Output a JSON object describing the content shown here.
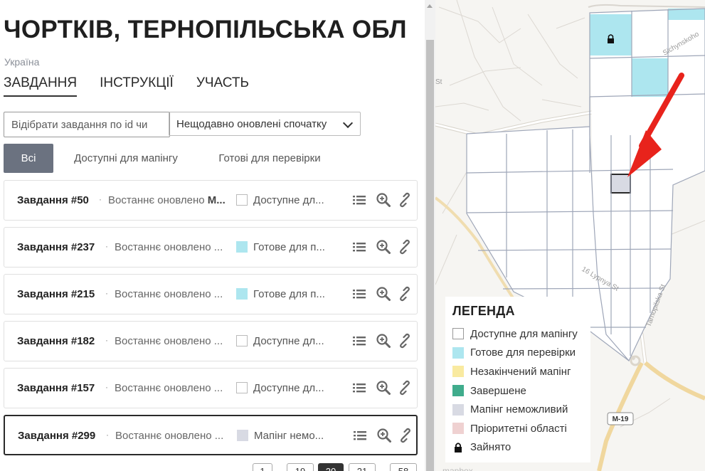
{
  "project": {
    "title": "ЧОРТКІВ, ТЕРНОПІЛЬСЬКА ОБЛ",
    "country": "Україна"
  },
  "tabs": [
    {
      "label": "ЗАВДАННЯ",
      "active": true
    },
    {
      "label": "ІНСТРУКЦІЇ",
      "active": false
    },
    {
      "label": "УЧАСТЬ",
      "active": false
    }
  ],
  "filters": {
    "id_placeholder": "Відібрати завдання по id чи",
    "sort_selected": "Нещодавно оновлені спочатку",
    "buttons": [
      {
        "label": "Всі",
        "active": true
      },
      {
        "label": "Доступні для мапінгу",
        "active": false
      },
      {
        "label": "Готові для перевірки",
        "active": false
      }
    ]
  },
  "tasks": [
    {
      "name": "Завдання #50",
      "updated": "Востаннє оновлено",
      "updated_bold": "M...",
      "status": "Доступне дл...",
      "status_color": "#ffffff",
      "selected": false
    },
    {
      "name": "Завдання #237",
      "updated": "Востаннє оновлено ...",
      "updated_bold": "",
      "status": "Готове для п...",
      "status_color": "#ade6ef",
      "selected": false
    },
    {
      "name": "Завдання #215",
      "updated": "Востаннє оновлено ...",
      "updated_bold": "",
      "status": "Готове для п...",
      "status_color": "#ade6ef",
      "selected": false
    },
    {
      "name": "Завдання #182",
      "updated": "Востаннє оновлено ...",
      "updated_bold": "",
      "status": "Доступне дл...",
      "status_color": "#ffffff",
      "selected": false
    },
    {
      "name": "Завдання #157",
      "updated": "Востаннє оновлено ...",
      "updated_bold": "",
      "status": "Доступне дл...",
      "status_color": "#ffffff",
      "selected": false
    },
    {
      "name": "Завдання #299",
      "updated": "Востаннє оновлено ...",
      "updated_bold": "",
      "status": "Мапінг немо...",
      "status_color": "#d8dae3",
      "selected": true
    }
  ],
  "pagination": [
    "1",
    "19",
    "20",
    "21",
    "58"
  ],
  "pagination_active": "20",
  "legend": {
    "title": "ЛЕГЕНДА",
    "items": [
      {
        "label": "Доступне для мапінгу",
        "color": "#ffffff"
      },
      {
        "label": "Готове для перевірки",
        "color": "#ade6ef"
      },
      {
        "label": "Незакінчений мапінг",
        "color": "#f9eaa0"
      },
      {
        "label": "Завершене",
        "color": "#40ac8c"
      },
      {
        "label": "Мапінг неможливий",
        "color": "#d8dae3"
      },
      {
        "label": "Пріоритетні області",
        "color": "#efd1d1"
      },
      {
        "label": "Зайнято",
        "color": "#000000",
        "icon": "lock-icon"
      }
    ]
  },
  "map": {
    "street_labels": [
      "16 Lypnya St",
      "Tarnopilska St",
      "Sichynskoho",
      "M-19",
      "St"
    ],
    "attribution": "mapbox"
  },
  "colors": {
    "grid": "#9ea6b8",
    "arrow": "#e8231c",
    "active_filter": "#6b7280"
  }
}
